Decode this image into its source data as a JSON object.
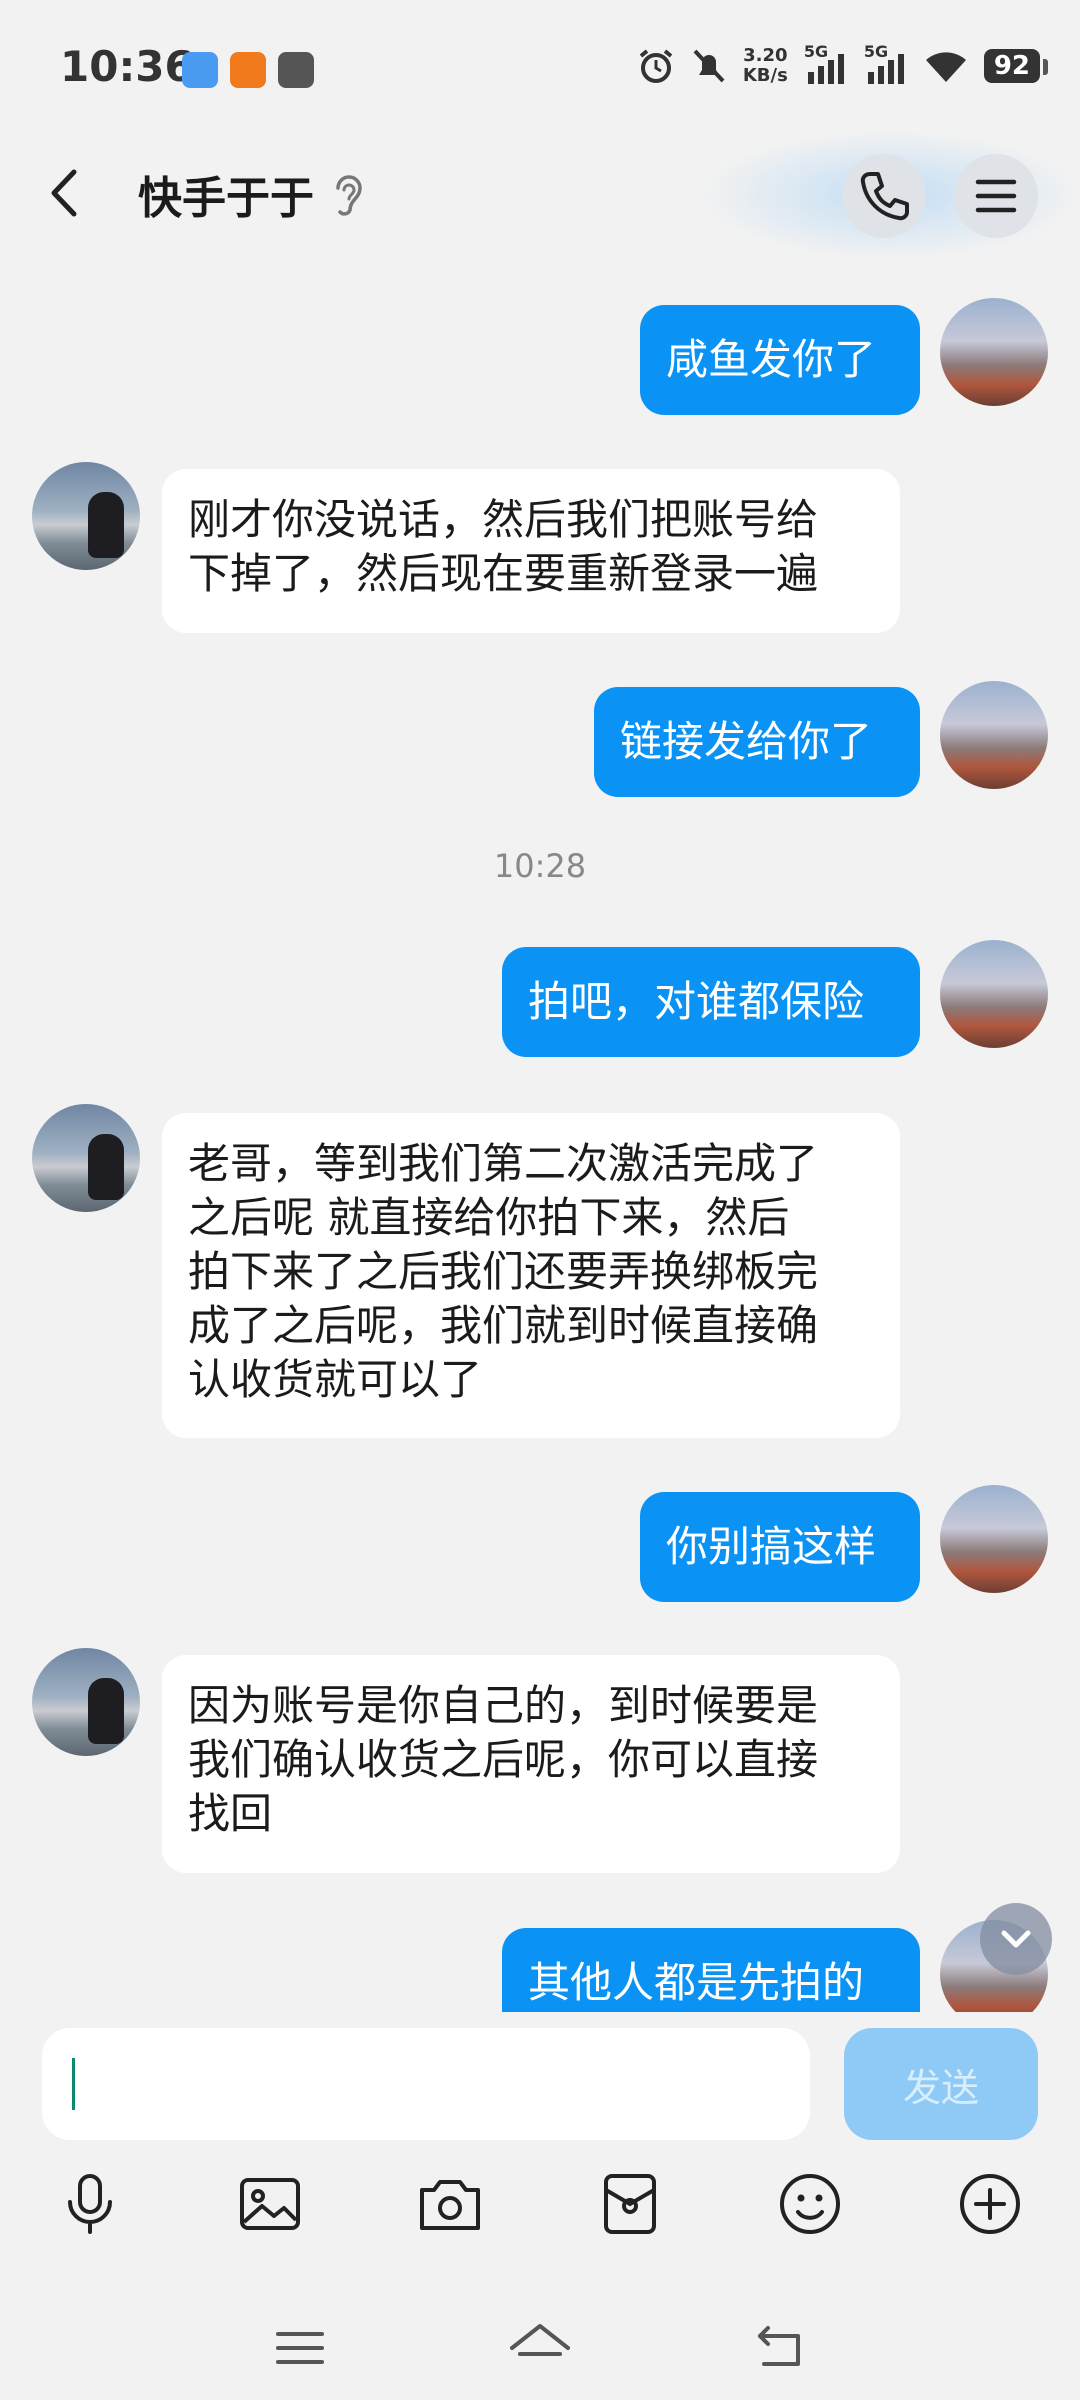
{
  "status_bar": {
    "time": "10:36",
    "net_speed_value": "3.20",
    "net_speed_unit": "KB/s",
    "signal_1": "5G",
    "signal_2": "5G",
    "battery": "92"
  },
  "header": {
    "title": "快手于于"
  },
  "messages": [
    {
      "from": "me",
      "text": "咸鱼发你了"
    },
    {
      "from": "other",
      "lines": [
        "刚才你没说话，然后我们把账号给",
        "下掉了，然后现在要重新登录一遍"
      ]
    },
    {
      "from": "me",
      "text": "链接发给你了"
    },
    {
      "timestamp": "10:28"
    },
    {
      "from": "me",
      "text": "拍吧，对谁都保险"
    },
    {
      "from": "other",
      "lines": [
        "老哥，等到我们第二次激活完成了",
        "之后呢 就直接给你拍下来，然后",
        "拍下来了之后我们还要弄换绑板完",
        "成了之后呢，我们就到时候直接确",
        "认收货就可以了"
      ]
    },
    {
      "from": "me",
      "text": "你别搞这样"
    },
    {
      "from": "other",
      "lines": [
        "因为账号是你自己的，到时候要是",
        "我们确认收货之后呢，你可以直接",
        "找回"
      ]
    },
    {
      "from": "me",
      "text": "其他人都是先拍的"
    }
  ],
  "input": {
    "value": "",
    "send_label": "发送"
  },
  "colors": {
    "outgoing_bubble": "#0a93f5",
    "incoming_bubble": "#ffffff",
    "send_button_disabled": "#8fcaf6",
    "background": "#f2f2f2"
  },
  "toolbar_icons": [
    "microphone-icon",
    "image-icon",
    "camera-icon",
    "red-packet-icon",
    "emoji-icon",
    "plus-icon"
  ],
  "nav_icons": [
    "menu-icon",
    "home-icon",
    "back-icon"
  ]
}
